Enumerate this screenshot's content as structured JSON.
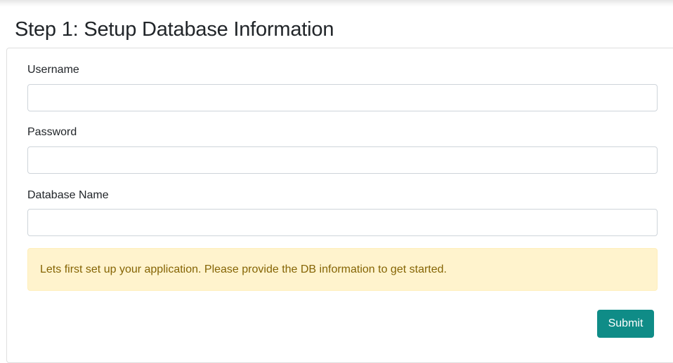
{
  "page": {
    "title": "Step 1: Setup Database Information"
  },
  "form": {
    "username": {
      "label": "Username",
      "value": "",
      "placeholder": ""
    },
    "password": {
      "label": "Password",
      "value": "",
      "placeholder": ""
    },
    "database_name": {
      "label": "Database Name",
      "value": "",
      "placeholder": ""
    },
    "alert_message": "Lets first set up your application. Please provide the DB information to get started.",
    "submit_label": "Submit"
  },
  "colors": {
    "accent": "#0f8c87",
    "alert_background": "#fff3cd",
    "alert_text": "#856404"
  }
}
